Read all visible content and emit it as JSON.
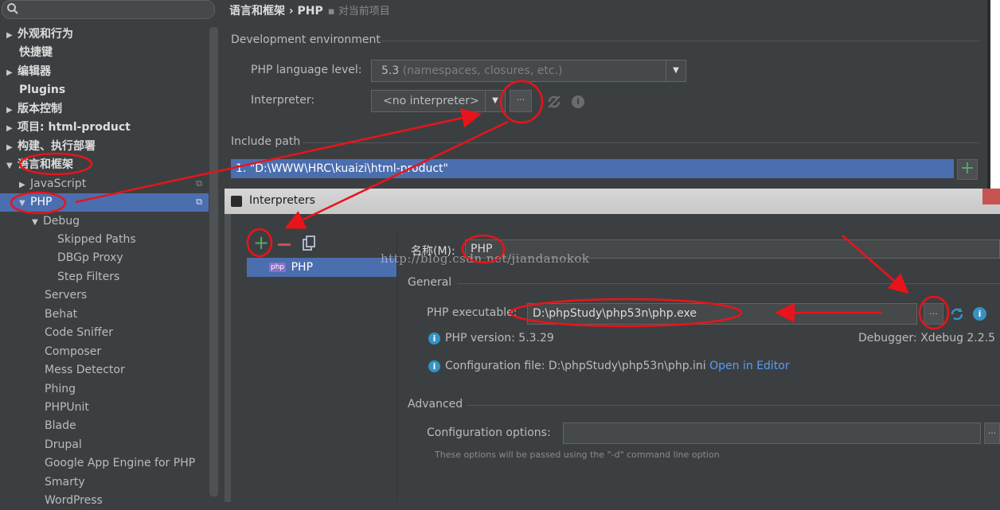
{
  "sidebar": {
    "search_placeholder": "",
    "items": [
      {
        "label": "外观和行为",
        "arrow": "▶"
      },
      {
        "label": "快捷键",
        "arrow": ""
      },
      {
        "label": "编辑器",
        "arrow": "▶"
      },
      {
        "label": "Plugins",
        "arrow": ""
      },
      {
        "label": "版本控制",
        "arrow": "▶"
      },
      {
        "label": "项目: html-product",
        "arrow": "▶"
      },
      {
        "label": "构建、执行部署",
        "arrow": "▶"
      },
      {
        "label": "语言和框架",
        "arrow": "▼"
      },
      {
        "label": "JavaScript",
        "arrow": "▶"
      },
      {
        "label": "PHP",
        "arrow": "▼"
      },
      {
        "label": "Debug",
        "arrow": "▼"
      },
      {
        "label": "Skipped Paths",
        "arrow": ""
      },
      {
        "label": "DBGp Proxy",
        "arrow": ""
      },
      {
        "label": "Step Filters",
        "arrow": ""
      },
      {
        "label": "Servers",
        "arrow": ""
      },
      {
        "label": "Behat",
        "arrow": ""
      },
      {
        "label": "Code Sniffer",
        "arrow": ""
      },
      {
        "label": "Composer",
        "arrow": ""
      },
      {
        "label": "Mess Detector",
        "arrow": ""
      },
      {
        "label": "Phing",
        "arrow": ""
      },
      {
        "label": "PHPUnit",
        "arrow": ""
      },
      {
        "label": "Blade",
        "arrow": ""
      },
      {
        "label": "Drupal",
        "arrow": ""
      },
      {
        "label": "Google App Engine for PHP",
        "arrow": ""
      },
      {
        "label": "Smarty",
        "arrow": ""
      },
      {
        "label": "WordPress",
        "arrow": ""
      }
    ]
  },
  "breadcrumb": {
    "path": "语言和框架 › PHP",
    "scope": "对当前项目"
  },
  "settings": {
    "dev_env_title": "Development environment",
    "lang_level_label": "PHP language level:",
    "lang_level_value": "5.3",
    "lang_level_hint": "(namespaces, closures, etc.)",
    "interpreter_label": "Interpreter:",
    "interpreter_value": "<no interpreter>",
    "dots": "···",
    "include_title": "Include path",
    "include_item": "1. \"D:\\WWW\\HRC\\kuaizi\\html-product\"",
    "plus": "+"
  },
  "dialog": {
    "title": "Interpreters",
    "list_item": "PHP",
    "list_item_icon_text": "php",
    "name_label": "名称(M):",
    "name_value": "PHP",
    "general_title": "General",
    "exe_label": "PHP executable:",
    "exe_value": "D:\\phpStudy\\php53n\\php.exe",
    "version_text": "PHP version: 5.3.29",
    "debugger_text": "Debugger: Xdebug 2.2.5",
    "config_text": "Configuration file: D:\\phpStudy\\php53n\\php.ini",
    "open_in_editor": "Open in Editor",
    "advanced_title": "Advanced",
    "config_options_label": "Configuration options:",
    "config_options_hint": "These options will be passed using the \"-d\" command line option",
    "dots": "···"
  },
  "watermark": "http://blog.csdn.net/jiandanokok",
  "colors": {
    "annotation": "#e8141b",
    "selection": "#4b6eaf",
    "add_green": "#59a869",
    "remove_red": "#c75450"
  }
}
